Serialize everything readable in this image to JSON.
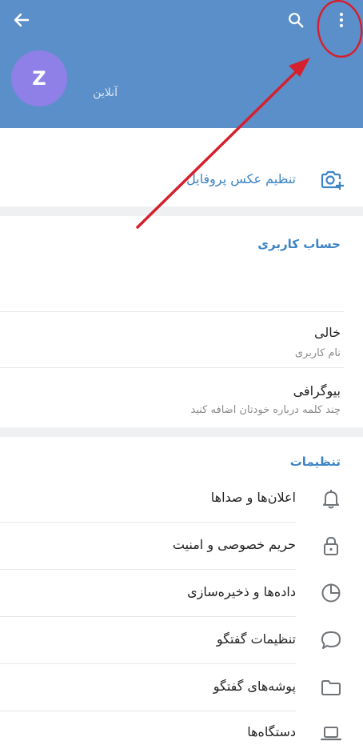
{
  "header": {
    "avatar_initial": "Z",
    "status": "آنلاین",
    "back_icon": "arrow-left-icon",
    "search_icon": "search-icon",
    "menu_icon": "more-vertical-icon"
  },
  "profile_photo": {
    "label": "تنظیم عکس پروفایل",
    "icon": "add-photo-camera-icon"
  },
  "account": {
    "title": "حساب کاربری",
    "username_value": "خالی",
    "username_label": "نام کاربری",
    "bio_value": "بیوگرافی",
    "bio_hint": "چند کلمه درباره خودتان اضافه کنید"
  },
  "settings": {
    "title": "تنظیمات",
    "items": [
      {
        "label": "اعلان‌ها و صداها",
        "icon": "bell-icon"
      },
      {
        "label": "حریم خصوصی و امنیت",
        "icon": "lock-icon"
      },
      {
        "label": "داده‌ها و ذخیره‌سازی",
        "icon": "pie-chart-icon"
      },
      {
        "label": "تنظیمات گفتگو",
        "icon": "chat-bubble-icon"
      },
      {
        "label": "پوشه‌های گفتگو",
        "icon": "folder-icon"
      },
      {
        "label": "دستگاه‌ها",
        "icon": "laptop-icon"
      }
    ]
  },
  "colors": {
    "header_bg": "#5b8fca",
    "accent": "#3d84c6",
    "avatar_bg": "#8e80e6",
    "annotation": "#d6202e"
  }
}
